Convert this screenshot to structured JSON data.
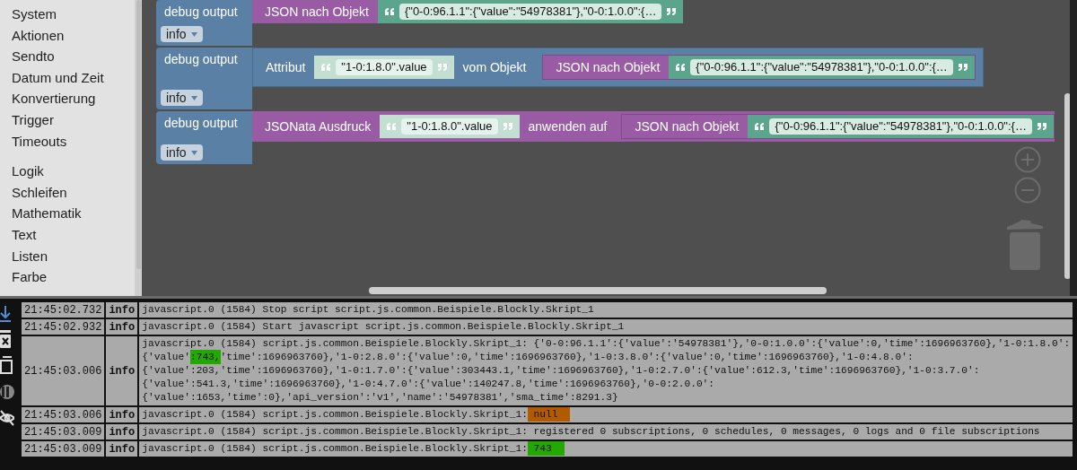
{
  "sidebar": {
    "groups": [
      [
        "System",
        "Aktionen",
        "Sendto",
        "Datum und Zeit",
        "Konvertierung",
        "Trigger",
        "Timeouts"
      ],
      [
        "Logik",
        "Schleifen",
        "Mathematik",
        "Text",
        "Listen",
        "Farbe"
      ]
    ]
  },
  "blocks": [
    {
      "label": "debug output",
      "dropdown": "info",
      "input": {
        "kind": "function",
        "parts": [
          {
            "kind": "label",
            "text": "JSON nach Objekt"
          },
          {
            "kind": "text",
            "value": "{\"0-0:96.1.1\":{\"value\":\"54978381\"},\"0-0:1.0.0\":{…"
          }
        ]
      }
    },
    {
      "label": "debug output",
      "dropdown": "info",
      "input": {
        "kind": "object",
        "parts": [
          {
            "kind": "label",
            "text": "Attribut"
          },
          {
            "kind": "shadow_text",
            "value": "\"1-0:1.8.0\".value"
          },
          {
            "kind": "label",
            "text": "vom Objekt"
          },
          {
            "kind": "function",
            "parts": [
              {
                "kind": "label",
                "text": "JSON nach Objekt"
              },
              {
                "kind": "text",
                "value": "{\"0-0:96.1.1\":{\"value\":\"54978381\"},\"0-0:1.0.0\":{…"
              }
            ]
          }
        ]
      }
    },
    {
      "label": "debug output",
      "dropdown": "info",
      "input": {
        "kind": "function",
        "parts": [
          {
            "kind": "label",
            "text": "JSONata Ausdruck"
          },
          {
            "kind": "shadow_text",
            "value": "\"1-0:1.8.0\".value"
          },
          {
            "kind": "label",
            "text": "anwenden auf"
          },
          {
            "kind": "function",
            "parts": [
              {
                "kind": "label",
                "text": "JSON nach Objekt"
              },
              {
                "kind": "text",
                "value": "{\"0-0:96.1.1\":{\"value\":\"54978381\"},\"0-0:1.0.0\":{…"
              }
            ]
          }
        ]
      }
    }
  ],
  "log": {
    "rows": [
      {
        "time": "21:45:02.732",
        "level": "info",
        "lines": [
          [
            {
              "text": "javascript.0 (1584) Stop script script.js.common.Beispiele.Blockly.Skript_1"
            }
          ]
        ]
      },
      {
        "time": "21:45:02.932",
        "level": "info",
        "lines": [
          [
            {
              "text": "javascript.0 (1584) Start javascript script.js.common.Beispiele.Blockly.Skript_1"
            }
          ]
        ]
      },
      {
        "time": "21:45:03.006",
        "level": "info",
        "lines": [
          [
            {
              "text": "javascript.0 (1584) script.js.common.Beispiele.Blockly.Skript_1: {'0-0:96.1.1':{'value':'54978381'},'0-0:1.0.0':{'value':0,'time':1696963760},'1-0:1.8.0':"
            }
          ],
          [
            {
              "text": "{'value'"
            },
            {
              "text": ":743,",
              "color": "#22a800"
            },
            {
              "text": "'time':1696963760},'1-0:2.8.0':{'value':0,'time':1696963760},'1-0:3.8.0':{'value':0,'time':1696963760},'1-0:4.8.0':"
            }
          ],
          [
            {
              "text": "{'value':203,'time':1696963760},'1-0:1.7.0':{'value':303443.1,'time':1696963760},'1-0:2.7.0':{'value':612.3,'time':1696963760},'1-0:3.7.0':"
            }
          ],
          [
            {
              "text": "{'value':541.3,'time':1696963760},'1-0:4.7.0':{'value':140247.8,'time':1696963760},'0-0:2.0.0':"
            }
          ],
          [
            {
              "text": "{'value':1653,'time':0},'api_version':'v1','name':'54978381','sma_time':8291.3}"
            }
          ]
        ]
      },
      {
        "time": "21:45:03.006",
        "level": "info",
        "lines": [
          [
            {
              "text": "javascript.0 (1584) script.js.common.Beispiele.Blockly.Skript_1:"
            },
            {
              "text": " null",
              "color": "#b25a00"
            }
          ]
        ]
      },
      {
        "time": "21:45:03.009",
        "level": "info",
        "lines": [
          [
            {
              "text": "javascript.0 (1584) script.js.common.Beispiele.Blockly.Skript_1: registered 0 subscriptions, 0 schedules, 0 messages, 0 logs and 0 file subscriptions"
            }
          ]
        ]
      },
      {
        "time": "21:45:03.009",
        "level": "info",
        "lines": [
          [
            {
              "text": "javascript.0 (1584) script.js.common.Beispiele.Blockly.Skript_1:"
            },
            {
              "text": " 743",
              "color": "#22a800"
            }
          ]
        ]
      }
    ]
  }
}
